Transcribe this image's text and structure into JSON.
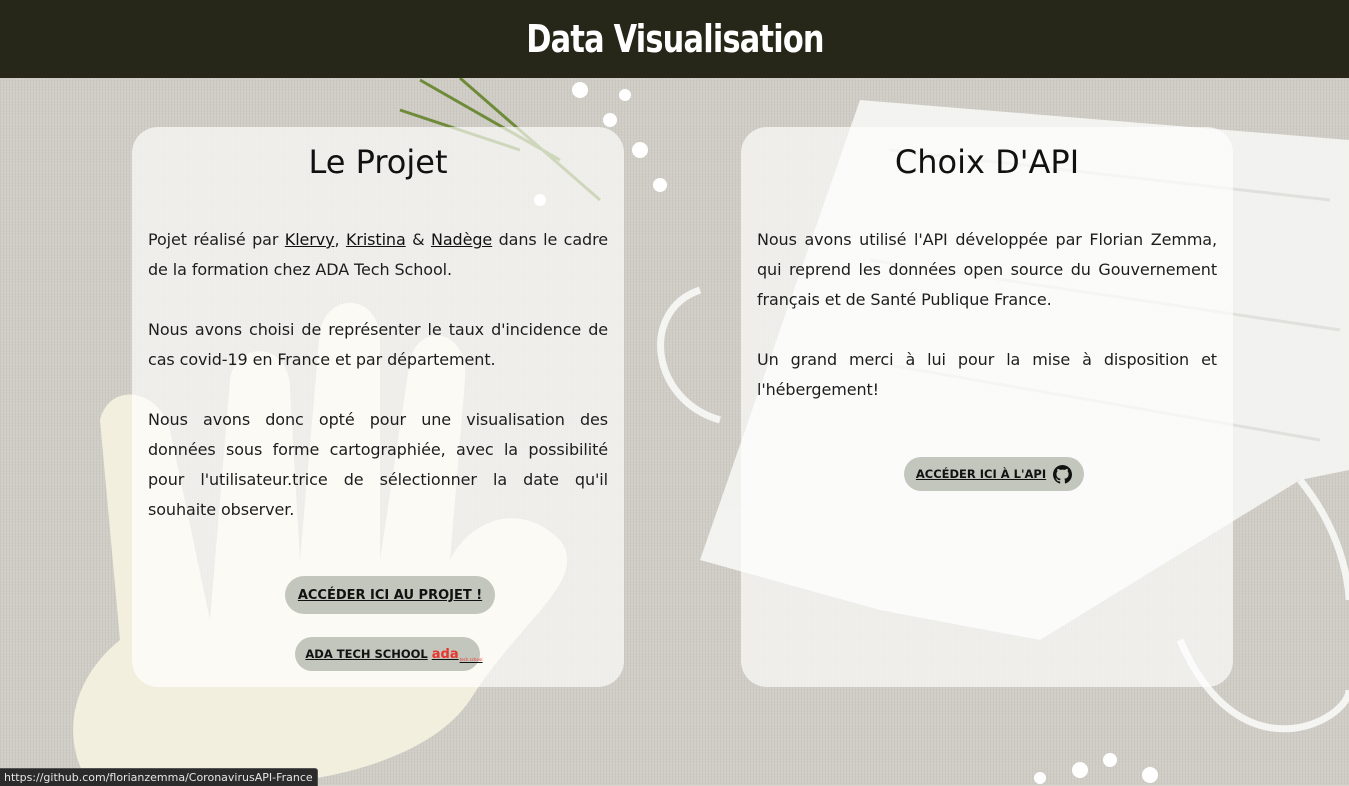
{
  "header": {
    "title": "Data Visualisation"
  },
  "project_card": {
    "title": "Le Projet",
    "intro_before": "Pojet réalisé par ",
    "author_links": [
      "Klervy",
      "Kristina",
      "Nadège"
    ],
    "sep_comma": ", ",
    "sep_and": " & ",
    "intro_after": " dans le cadre de la formation chez ADA Tech School.",
    "paragraph_2": "Nous avons choisi de représenter le taux d'incidence de cas covid-19 en France et par département.",
    "paragraph_3": "Nous avons donc opté pour une visualisation des données sous forme cartographiée, avec la possibilité pour l'utilisateur.trice de sélectionner la date qu'il souhaite observer.",
    "project_button": "ACCÉDER ICI AU PROJET !",
    "school_button": "ADA TECH SCHOOL",
    "school_logo_text": "ada",
    "school_logo_tagline": "tech school"
  },
  "api_card": {
    "title": "Choix D'API",
    "paragraph_1": "Nous avons utilisé l'API développée par Florian Zemma, qui reprend les données open source du Gouvernement français et de Santé Publique France.",
    "paragraph_2": "Un grand merci à lui pour la mise à disposition et l'hébergement!",
    "api_button": "ACCÉDER ICI À L'API",
    "api_button_icon": "github-icon"
  },
  "status_bar": {
    "url": "https://github.com/florianzemma/CoronavirusAPI-France"
  },
  "colors": {
    "header_bg": "#262719",
    "button_bg": "#c3c6bd",
    "ada_red": "#e8352e"
  }
}
